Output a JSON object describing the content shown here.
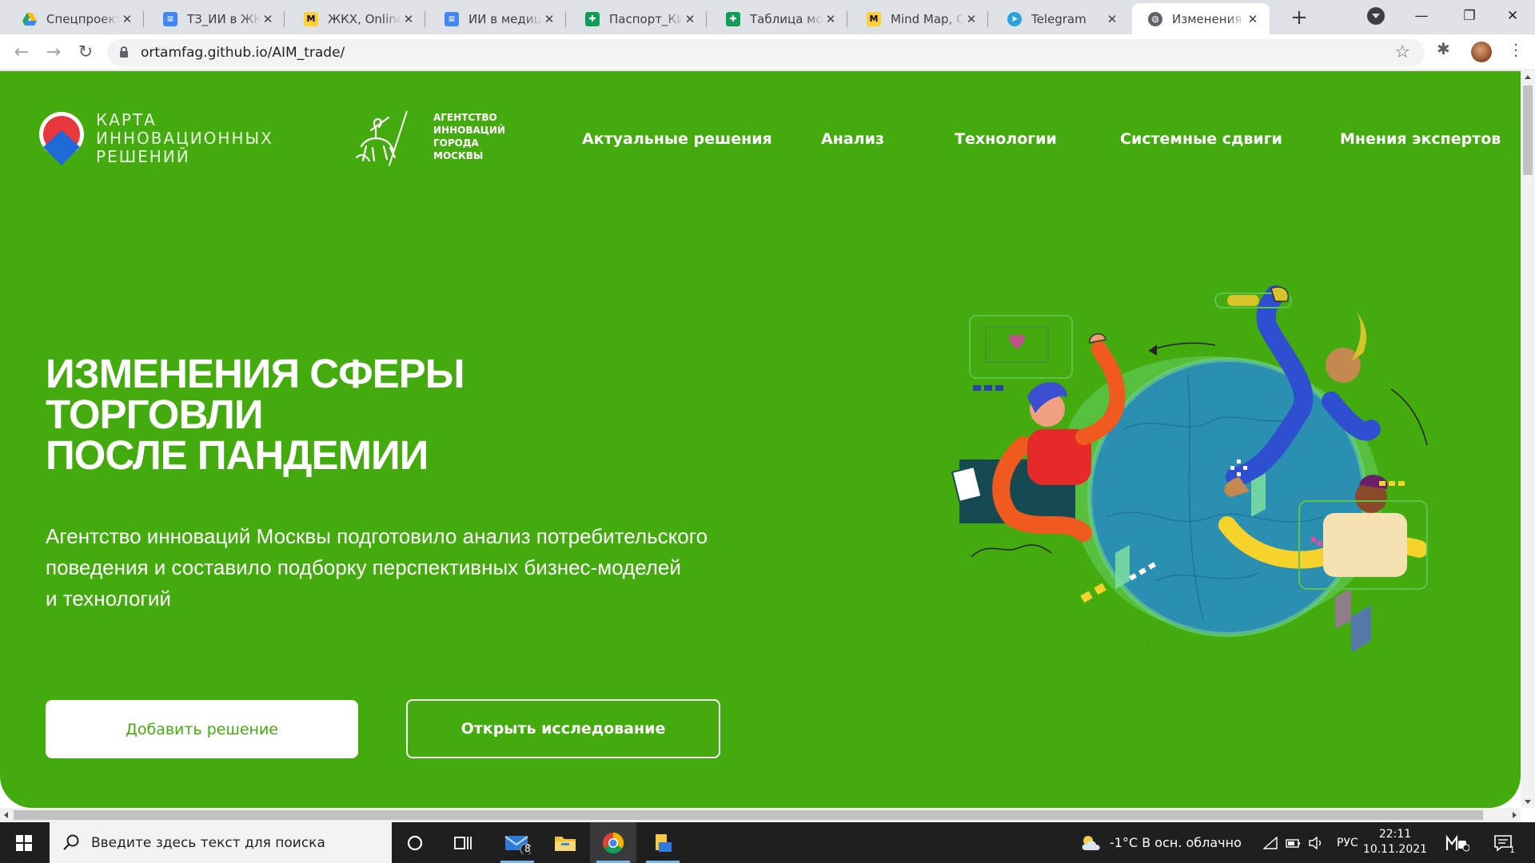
{
  "browser": {
    "tabs": [
      {
        "title": "Спецпроекты",
        "favicon": "google-drive-icon",
        "color": "#1fa463",
        "active": false
      },
      {
        "title": "ТЗ_ИИ в ЖКХ",
        "favicon": "google-docs-icon",
        "color": "#4285f4",
        "active": false
      },
      {
        "title": "ЖКХ, Online W",
        "favicon": "miro-icon",
        "color": "#ffd02f",
        "active": false
      },
      {
        "title": "ИИ в медици",
        "favicon": "google-docs-icon",
        "color": "#4285f4",
        "active": false
      },
      {
        "title": "Паспорт_КИР",
        "favicon": "google-sheets-icon",
        "color": "#0f9d58",
        "active": false
      },
      {
        "title": "Таблица мони",
        "favicon": "google-sheets-icon",
        "color": "#0f9d58",
        "active": false
      },
      {
        "title": "Mind Map, On",
        "favicon": "miro-icon",
        "color": "#ffd02f",
        "active": false
      },
      {
        "title": "Telegram",
        "favicon": "telegram-icon",
        "color": "#2aa3e0",
        "active": false
      },
      {
        "title": "Изменения сф",
        "favicon": "globe-icon",
        "color": "#5f6368",
        "active": true
      }
    ],
    "url": "ortamfag.github.io/AIM_trade/"
  },
  "site": {
    "logo_text": [
      "КАРТА",
      "ИННОВАЦИОННЫХ",
      "РЕШЕНИЙ"
    ],
    "agency_text": [
      "АГЕНТСТВО",
      "ИННОВАЦИЙ",
      "ГОРОДА",
      "МОСКВЫ"
    ],
    "nav": [
      "Актуальные решения",
      "Анализ",
      "Технологии",
      "Системные сдвиги",
      "Мнения экспертов"
    ],
    "hero": {
      "title_lines": [
        "ИЗМЕНЕНИЯ СФЕРЫ",
        "ТОРГОВЛИ",
        "ПОСЛЕ ПАНДЕМИИ"
      ],
      "lead_lines": [
        "Агентство инноваций Москвы подготовило анализ потребительского",
        "поведения и составило подборку перспективных бизнес-моделей",
        "и технологий"
      ],
      "primary_button": "Добавить решение",
      "secondary_button": "Открыть исследование"
    },
    "colors": {
      "accent": "#44ab0f",
      "white": "#ffffff"
    }
  },
  "taskbar": {
    "search_placeholder": "Введите здесь текст для поиска",
    "mail_badge": "8",
    "weather": "-1°C  В осн. облачно",
    "language": "РУС",
    "time": "22:11",
    "date": "10.11.2021",
    "notifications": "1"
  }
}
